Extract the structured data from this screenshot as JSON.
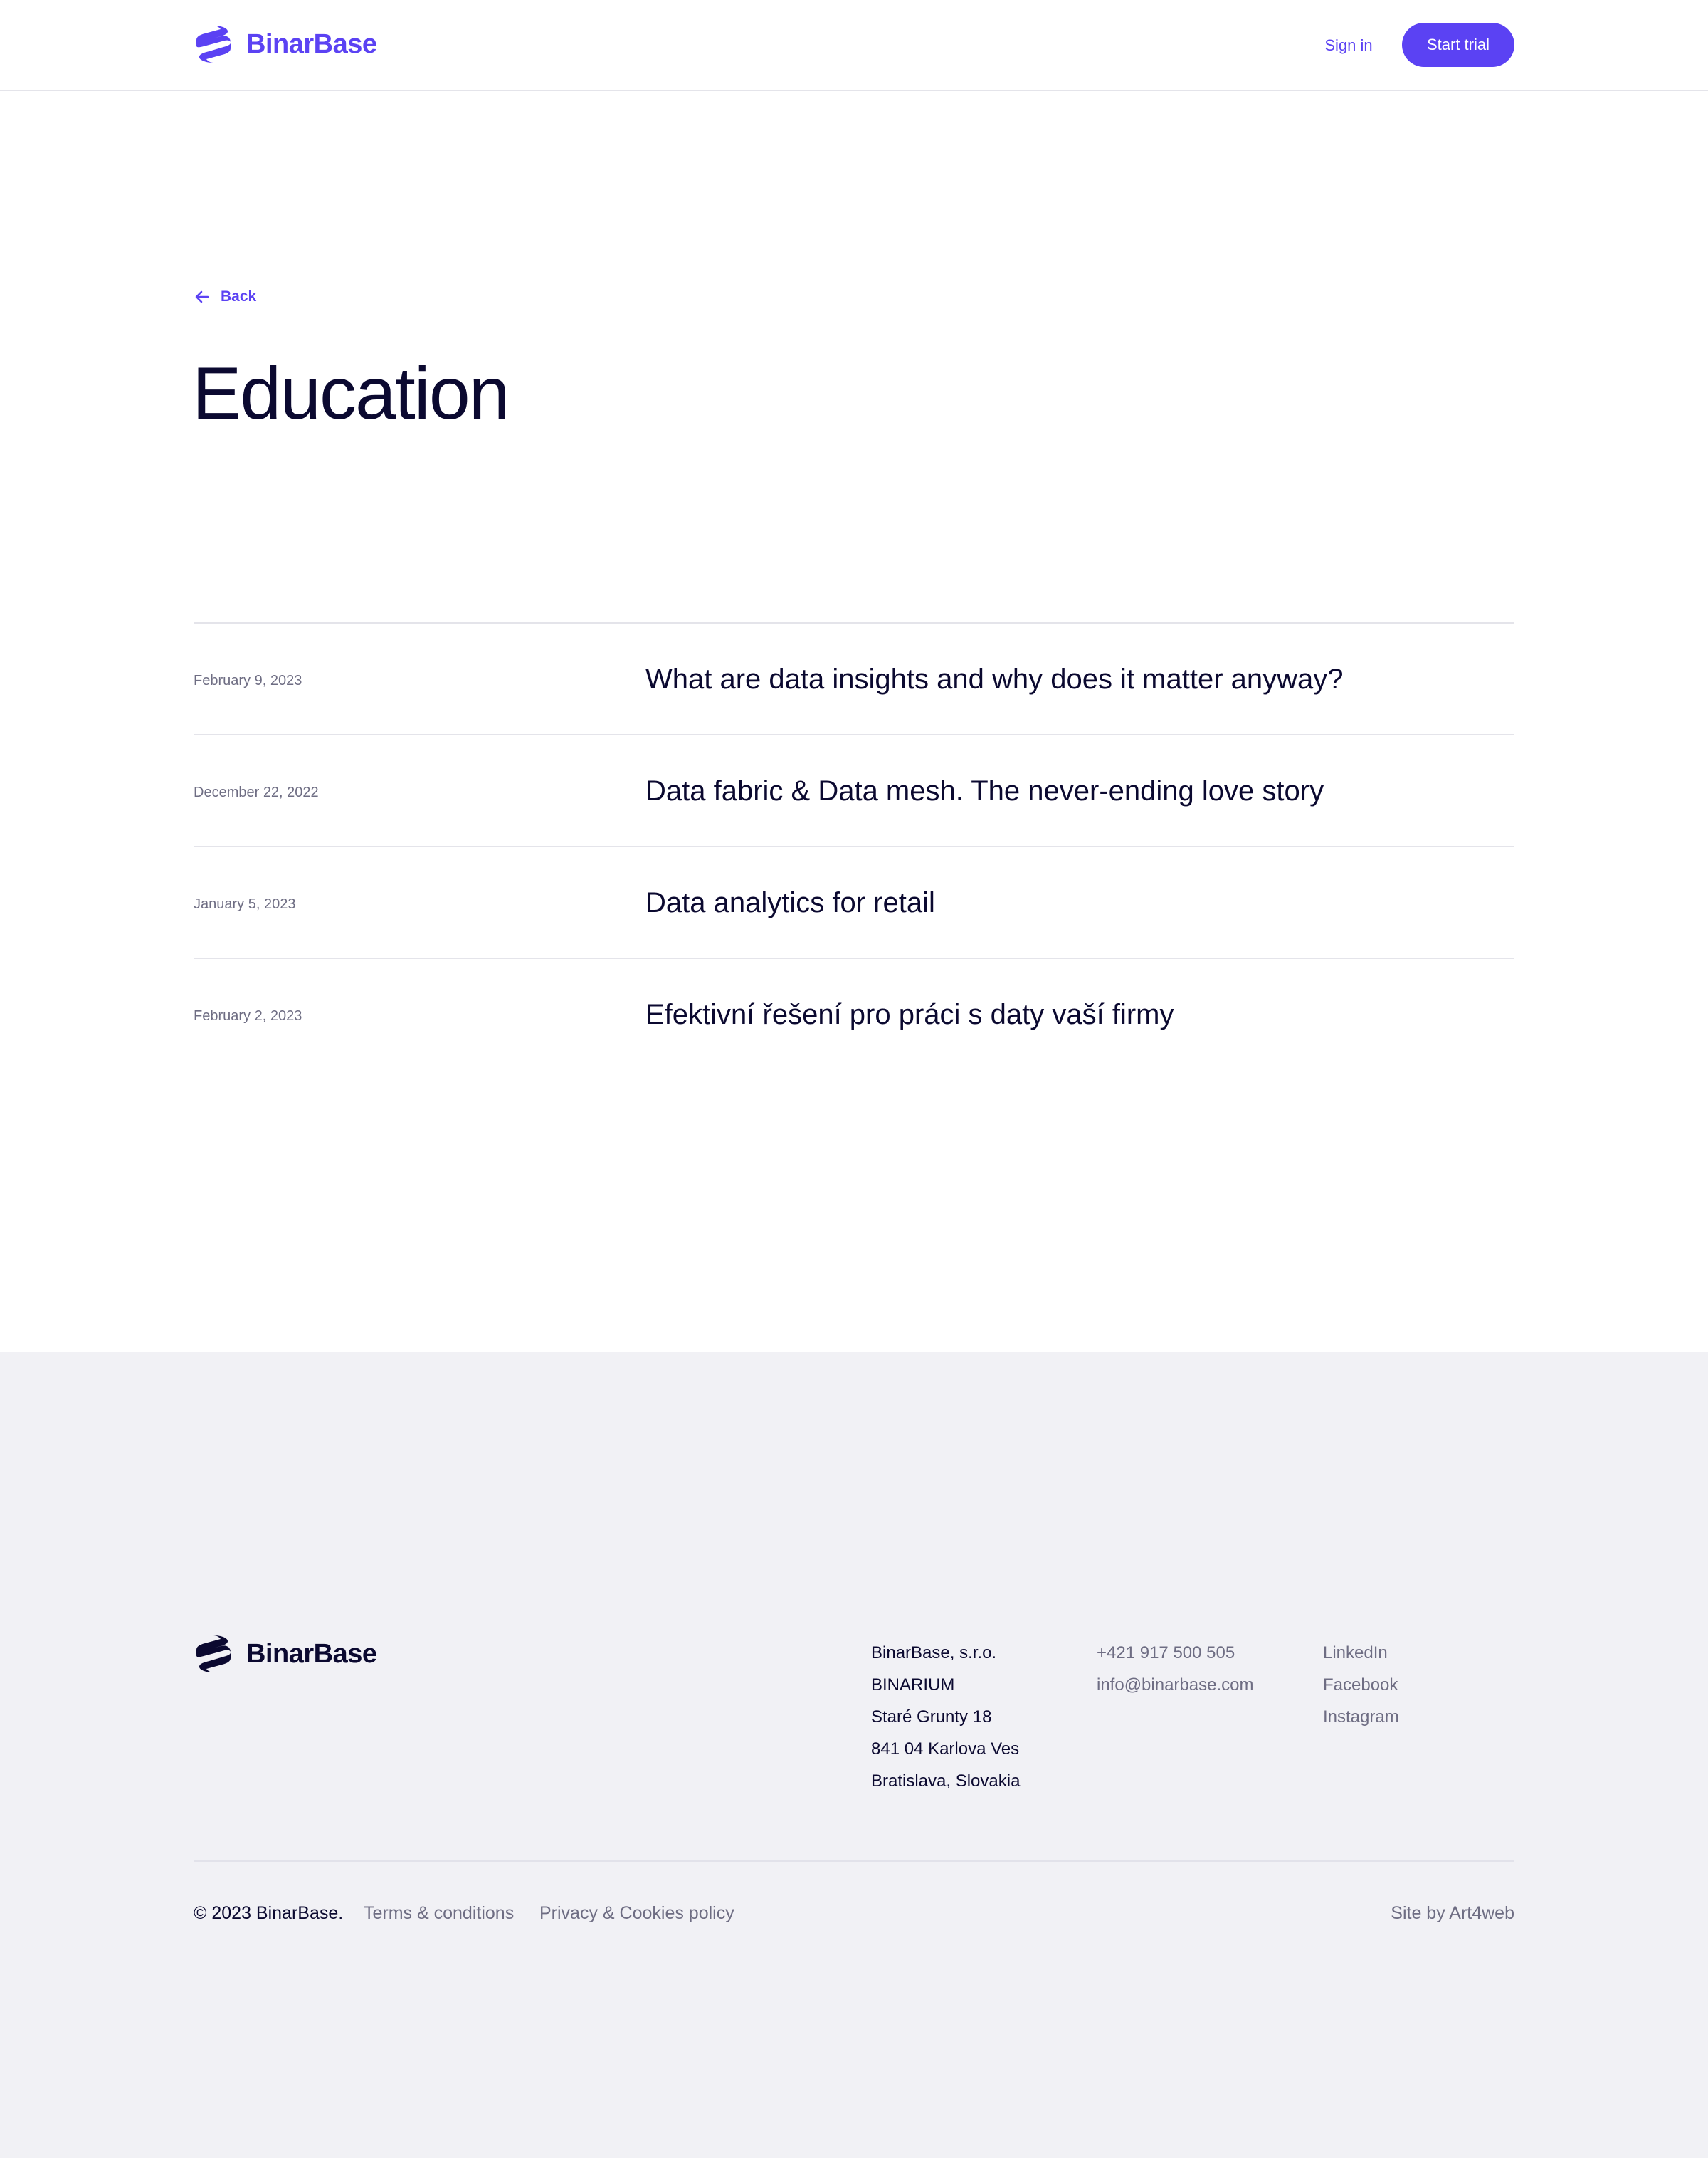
{
  "colors": {
    "brand": "#5b42f3",
    "text_dark": "#0b0930",
    "text_muted": "#6e6d83",
    "divider": "#e4e4ea",
    "footer_bg": "#f1f1f5"
  },
  "header": {
    "logo_text": "BinarBase",
    "logo_icon": "binarbase-logo-icon",
    "sign_in_label": "Sign in",
    "start_trial_label": "Start trial"
  },
  "back": {
    "label": "Back",
    "icon": "arrow-left-icon"
  },
  "page": {
    "title": "Education"
  },
  "articles": [
    {
      "date": "February 9, 2023",
      "title": "What are data insights and why does it matter anyway?"
    },
    {
      "date": "December 22, 2022",
      "title": "Data fabric & Data mesh. The never-ending love story"
    },
    {
      "date": "January 5, 2023",
      "title": "Data analytics for retail"
    },
    {
      "date": "February 2, 2023",
      "title": "Efektivní řešení pro práci s daty vaší firmy"
    }
  ],
  "footer": {
    "logo_text": "BinarBase",
    "address": [
      "BinarBase, s.r.o.",
      "BINARIUM",
      "Staré Grunty 18",
      "841 04 Karlova Ves",
      "Bratislava, Slovakia"
    ],
    "contact": [
      "+421 917 500 505",
      "info@binarbase.com"
    ],
    "social": [
      "LinkedIn",
      "Facebook",
      "Instagram"
    ],
    "copyright": "© 2023 BinarBase.",
    "terms_label": "Terms & conditions",
    "privacy_label": "Privacy & Cookies policy",
    "site_by": "Site by Art4web"
  }
}
